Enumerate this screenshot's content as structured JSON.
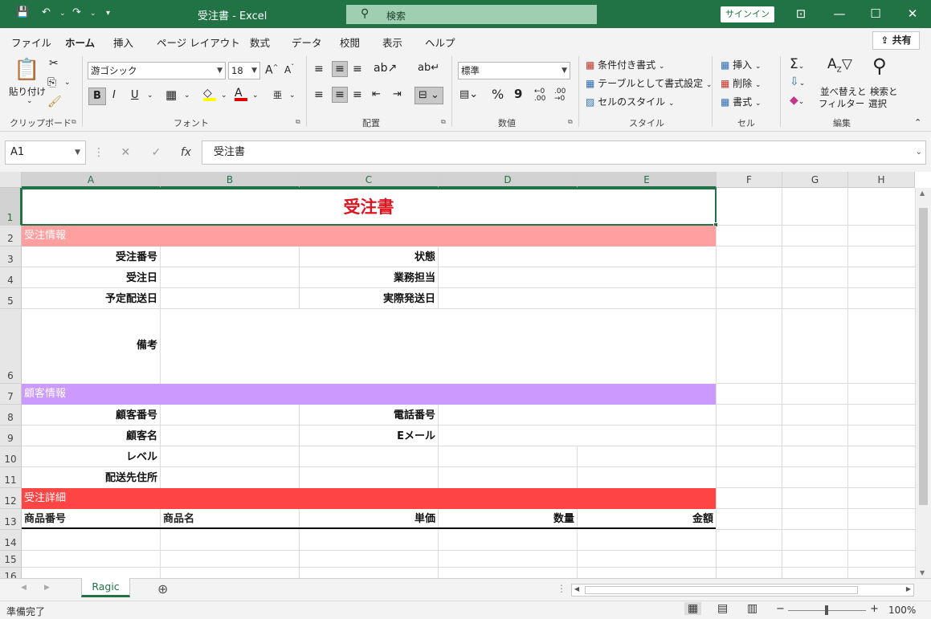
{
  "titlebar": {
    "title": "受注書  -  Excel",
    "search_placeholder": "検索",
    "signin": "サインイン"
  },
  "menu": {
    "tabs": [
      "ファイル",
      "ホーム",
      "挿入",
      "ページ レイアウト",
      "数式",
      "データ",
      "校閲",
      "表示",
      "ヘルプ"
    ],
    "active_tab": "ホーム",
    "share": "共有"
  },
  "ribbon": {
    "clipboard": {
      "paste": "貼り付け",
      "group": "クリップボード"
    },
    "font": {
      "name": "游ゴシック",
      "size": "18",
      "bold": "B",
      "italic": "I",
      "underline": "U",
      "group": "フォント"
    },
    "alignment": {
      "group": "配置"
    },
    "number": {
      "format": "標準",
      "percent": "%",
      "comma": "9",
      "group": "数値"
    },
    "styles": {
      "conditional": "条件付き書式",
      "table": "テーブルとして書式設定",
      "cell_styles": "セルのスタイル",
      "group": "スタイル"
    },
    "cells": {
      "insert": "挿入",
      "delete": "削除",
      "format": "書式",
      "group": "セル"
    },
    "editing": {
      "sort1": "並べ替えと",
      "sort2": "フィルター",
      "find1": "検索と",
      "find2": "選択",
      "group": "編集"
    }
  },
  "formula_bar": {
    "namebox": "A1",
    "fx": "fx",
    "content": "受注書"
  },
  "columns": [
    "A",
    "B",
    "C",
    "D",
    "E",
    "F",
    "G",
    "H"
  ],
  "rows": [
    "1",
    "2",
    "3",
    "4",
    "5",
    "6",
    "7",
    "8",
    "9",
    "10",
    "11",
    "12",
    "13",
    "14",
    "15",
    "16"
  ],
  "sheet": {
    "title": "受注書",
    "title_color": "#e0141e",
    "section_order": "受注情報",
    "section_order_color": "#ff9f9f",
    "section_customer": "顧客情報",
    "section_customer_color": "#cc99ff",
    "section_detail": "受注詳細",
    "section_detail_color": "#ff4444",
    "order_no": "受注番号",
    "status": "状態",
    "order_date": "受注日",
    "staff": "業務担当",
    "planned_ship": "予定配送日",
    "actual_ship": "実際発送日",
    "notes": "備考",
    "customer_no": "顧客番号",
    "phone": "電話番号",
    "customer_name": "顧客名",
    "email": "Eメール",
    "level": "レベル",
    "address": "配送先住所",
    "col_product_no": "商品番号",
    "col_product_name": "商品名",
    "col_price": "単価",
    "col_qty": "数量",
    "col_amount": "金額"
  },
  "sheet_tab": "Ragic",
  "status": {
    "ready": "準備完了",
    "zoom": "100%"
  }
}
